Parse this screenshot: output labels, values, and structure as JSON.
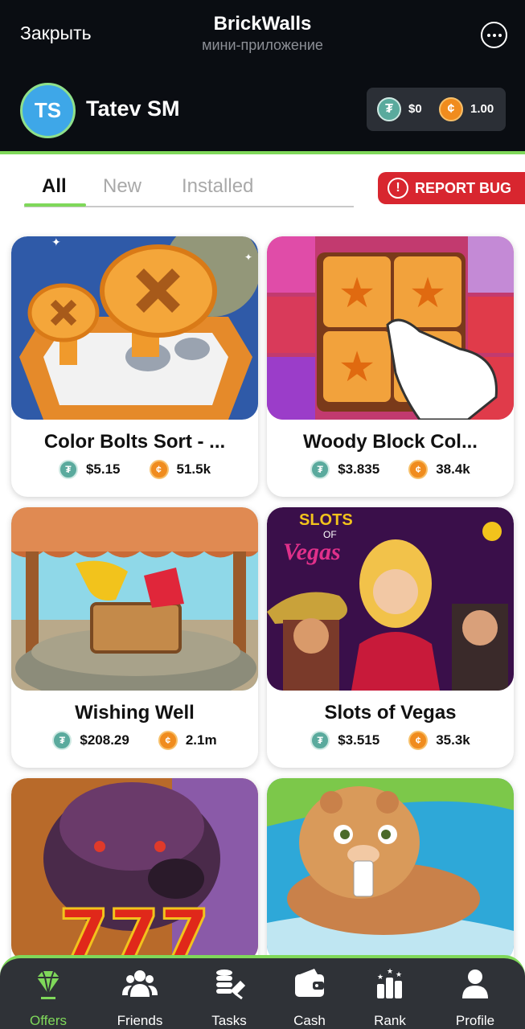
{
  "header": {
    "close_label": "Закрыть",
    "app_title": "BrickWalls",
    "app_subtitle": "мини-приложение"
  },
  "user": {
    "initials": "TS",
    "name": "Tatev SM",
    "balance_usdt": "$0",
    "balance_coins": "1.00"
  },
  "tabs": [
    {
      "label": "All",
      "active": true
    },
    {
      "label": "New",
      "active": false
    },
    {
      "label": "Installed",
      "active": false
    }
  ],
  "report_bug_label": "REPORT BUG",
  "offers": [
    {
      "title": "Color Bolts Sort - ...",
      "usd": "$5.15",
      "coins": "51.5k"
    },
    {
      "title": "Woody Block Col...",
      "usd": "$3.835",
      "coins": "38.4k"
    },
    {
      "title": "Wishing Well",
      "usd": "$208.29",
      "coins": "2.1m"
    },
    {
      "title": "Slots of Vegas",
      "usd": "$3.515",
      "coins": "35.3k"
    },
    {
      "title": "",
      "usd": "",
      "coins": ""
    },
    {
      "title": "",
      "usd": "",
      "coins": ""
    }
  ],
  "thumb_art": {
    "slots_logo_line1": "SLOTS",
    "slots_logo_line2": "OF",
    "slots_logo_line3": "Vegas",
    "buffalo_sevens": "777"
  },
  "nav": [
    {
      "label": "Offers",
      "icon": "gem-icon",
      "active": true
    },
    {
      "label": "Friends",
      "icon": "friends-icon",
      "active": false
    },
    {
      "label": "Tasks",
      "icon": "tasks-icon",
      "active": false
    },
    {
      "label": "Cash",
      "icon": "wallet-icon",
      "active": false
    },
    {
      "label": "Rank",
      "icon": "rank-icon",
      "active": false
    },
    {
      "label": "Profile",
      "icon": "profile-icon",
      "active": false
    }
  ],
  "colors": {
    "accent": "#7fd85a",
    "topbar": "#0a0d12",
    "report": "#d8262f",
    "usdt": "#5aaa9d",
    "coin": "#f08c1e"
  }
}
